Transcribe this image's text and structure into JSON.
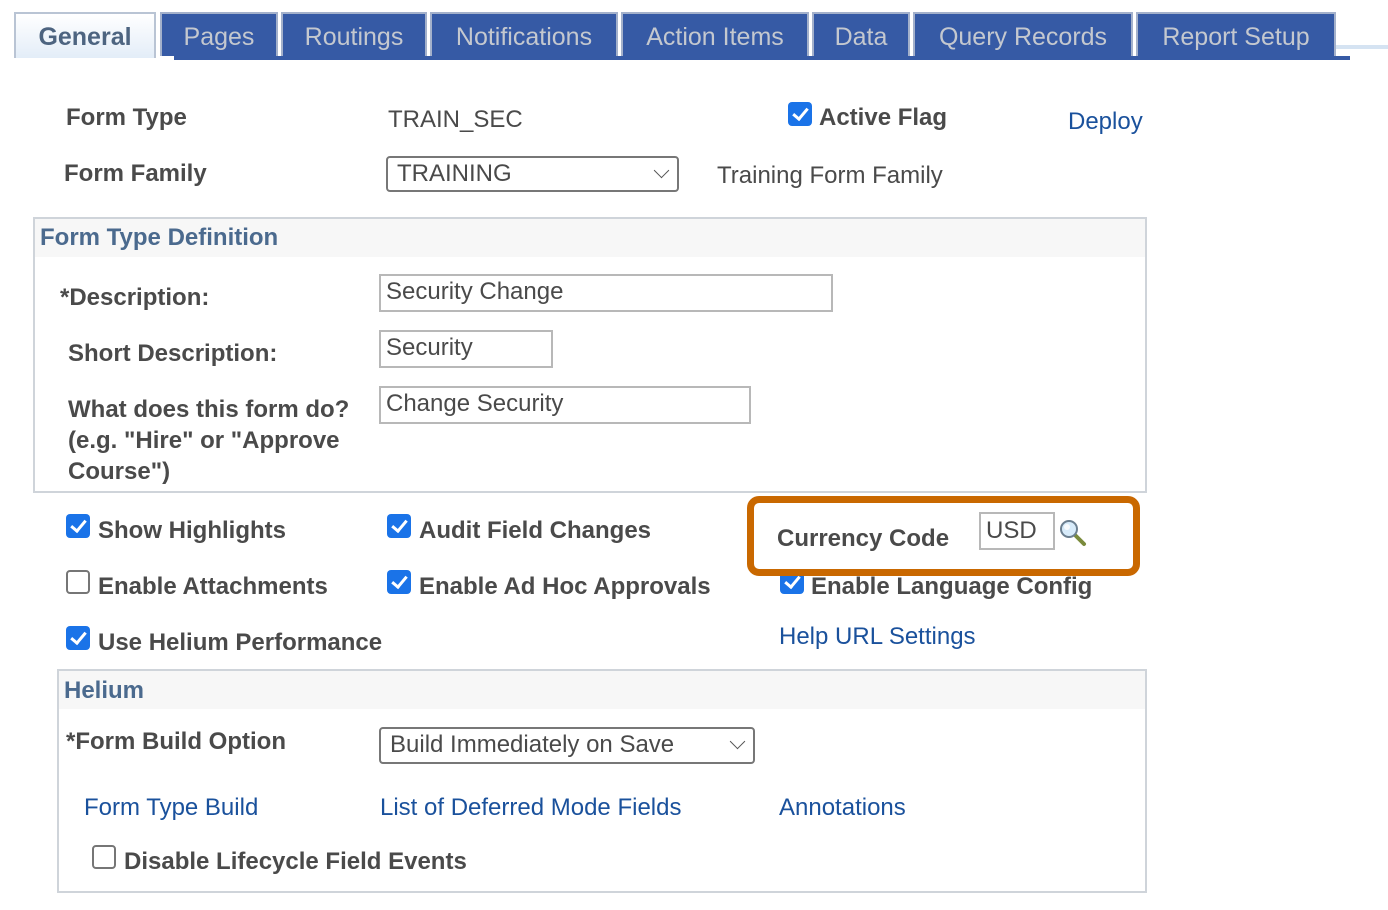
{
  "tabs": [
    {
      "label": "General",
      "active": true
    },
    {
      "label": "Pages",
      "active": false
    },
    {
      "label": "Routings",
      "active": false
    },
    {
      "label": "Notifications",
      "active": false
    },
    {
      "label": "Action Items",
      "active": false
    },
    {
      "label": "Data",
      "active": false
    },
    {
      "label": "Query Records",
      "active": false
    },
    {
      "label": "Report Setup",
      "active": false
    }
  ],
  "header": {
    "form_type_label": "Form Type",
    "form_type_value": "TRAIN_SEC",
    "active_flag_label": "Active Flag",
    "active_flag_checked": true,
    "deploy_link": "Deploy",
    "form_family_label": "Form Family",
    "form_family_value": "TRAINING",
    "form_family_description": "Training Form Family"
  },
  "definition": {
    "title": "Form Type Definition",
    "description_label": "*Description:",
    "description_value": "Security Change",
    "short_description_label": "Short Description:",
    "short_description_value": "Security",
    "what_label_line1": "What does this form do?",
    "what_label_line2": "(e.g. \"Hire\" or \"Approve",
    "what_label_line3": "Course\")",
    "what_value": "Change Security"
  },
  "options": {
    "show_highlights": {
      "label": "Show Highlights",
      "checked": true
    },
    "audit_field_changes": {
      "label": "Audit Field Changes",
      "checked": true
    },
    "enable_attachments": {
      "label": "Enable Attachments",
      "checked": false
    },
    "enable_ad_hoc_approvals": {
      "label": "Enable Ad Hoc Approvals",
      "checked": true
    },
    "enable_language_config": {
      "label": "Enable Language Config",
      "checked": true
    },
    "use_helium_performance": {
      "label": "Use Helium Performance",
      "checked": true
    },
    "currency_code_label": "Currency Code",
    "currency_code_value": "USD",
    "help_url_settings_link": "Help URL Settings"
  },
  "helium": {
    "title": "Helium",
    "form_build_option_label": "*Form Build Option",
    "form_build_option_value": "Build Immediately on Save",
    "form_type_build_link": "Form Type Build",
    "deferred_fields_link": "List of Deferred Mode Fields",
    "annotations_link": "Annotations",
    "disable_lifecycle": {
      "label": "Disable Lifecycle Field Events",
      "checked": false
    }
  },
  "colors": {
    "tab_blue": "#365aa5",
    "link_blue": "#1a519c",
    "checkbox_blue": "#1a73e8",
    "highlight_orange": "#c96800",
    "section_title": "#4b6a8e"
  }
}
